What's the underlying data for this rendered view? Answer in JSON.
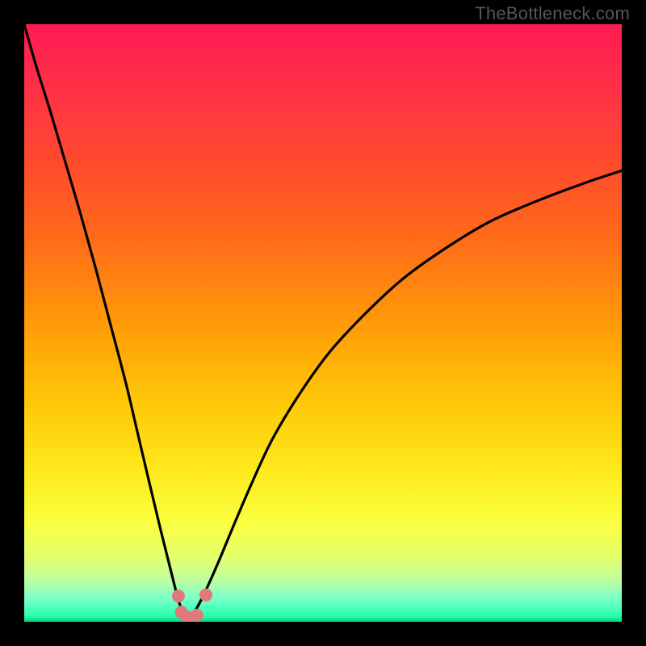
{
  "watermark": "TheBottleneck.com",
  "colors": {
    "frame": "#000000",
    "watermark_text": "#565656",
    "gradient_stops": [
      {
        "offset": 0.0,
        "color": "#ff1a54"
      },
      {
        "offset": 0.1,
        "color": "#ff2f48"
      },
      {
        "offset": 0.22,
        "color": "#ff482f"
      },
      {
        "offset": 0.35,
        "color": "#ff681a"
      },
      {
        "offset": 0.5,
        "color": "#ff9a08"
      },
      {
        "offset": 0.62,
        "color": "#ffc308"
      },
      {
        "offset": 0.73,
        "color": "#fee418"
      },
      {
        "offset": 0.83,
        "color": "#fbff3e"
      },
      {
        "offset": 0.89,
        "color": "#e6ff6a"
      },
      {
        "offset": 0.93,
        "color": "#bdffa0"
      },
      {
        "offset": 0.96,
        "color": "#7dffc8"
      },
      {
        "offset": 0.99,
        "color": "#2affb2"
      },
      {
        "offset": 1.0,
        "color": "#00d877"
      }
    ],
    "curve_stroke": "#000000",
    "marker_fill": "#e07a7a"
  },
  "chart_data": {
    "type": "line",
    "title": "",
    "xlabel": "",
    "ylabel": "",
    "xlim": [
      0,
      100
    ],
    "ylim": [
      0,
      100
    ],
    "note": "Axis values are normalized estimates read from the image (0–100). The curve resembles an absolute-deviation / bottleneck curve with its minimum around x≈27.",
    "series": [
      {
        "name": "bottleneck-curve-left",
        "x": [
          0.0,
          2.0,
          4.5,
          7.0,
          9.5,
          12.0,
          14.5,
          17.0,
          19.0,
          21.0,
          22.8,
          24.3,
          25.3,
          26.0,
          26.6,
          27.0
        ],
        "y": [
          100.0,
          93.0,
          85.0,
          76.5,
          68.0,
          59.0,
          49.5,
          40.0,
          31.5,
          23.0,
          15.5,
          9.5,
          5.5,
          3.0,
          1.3,
          0.5
        ]
      },
      {
        "name": "bottleneck-curve-right",
        "x": [
          27.0,
          28.0,
          29.0,
          30.5,
          32.5,
          35.0,
          38.0,
          41.5,
          46.0,
          51.0,
          57.0,
          63.5,
          70.5,
          78.0,
          86.0,
          94.0,
          100.0
        ],
        "y": [
          0.5,
          1.0,
          2.5,
          5.5,
          10.0,
          16.0,
          23.0,
          30.5,
          38.0,
          45.0,
          51.5,
          57.5,
          62.5,
          67.0,
          70.5,
          73.5,
          75.5
        ]
      }
    ],
    "markers": {
      "name": "highlight-points",
      "points": [
        {
          "x": 25.8,
          "y": 4.3
        },
        {
          "x": 26.3,
          "y": 1.6
        },
        {
          "x": 27.3,
          "y": 0.8
        },
        {
          "x": 28.9,
          "y": 1.1
        },
        {
          "x": 30.4,
          "y": 4.5
        }
      ],
      "radius_px": 8
    }
  }
}
